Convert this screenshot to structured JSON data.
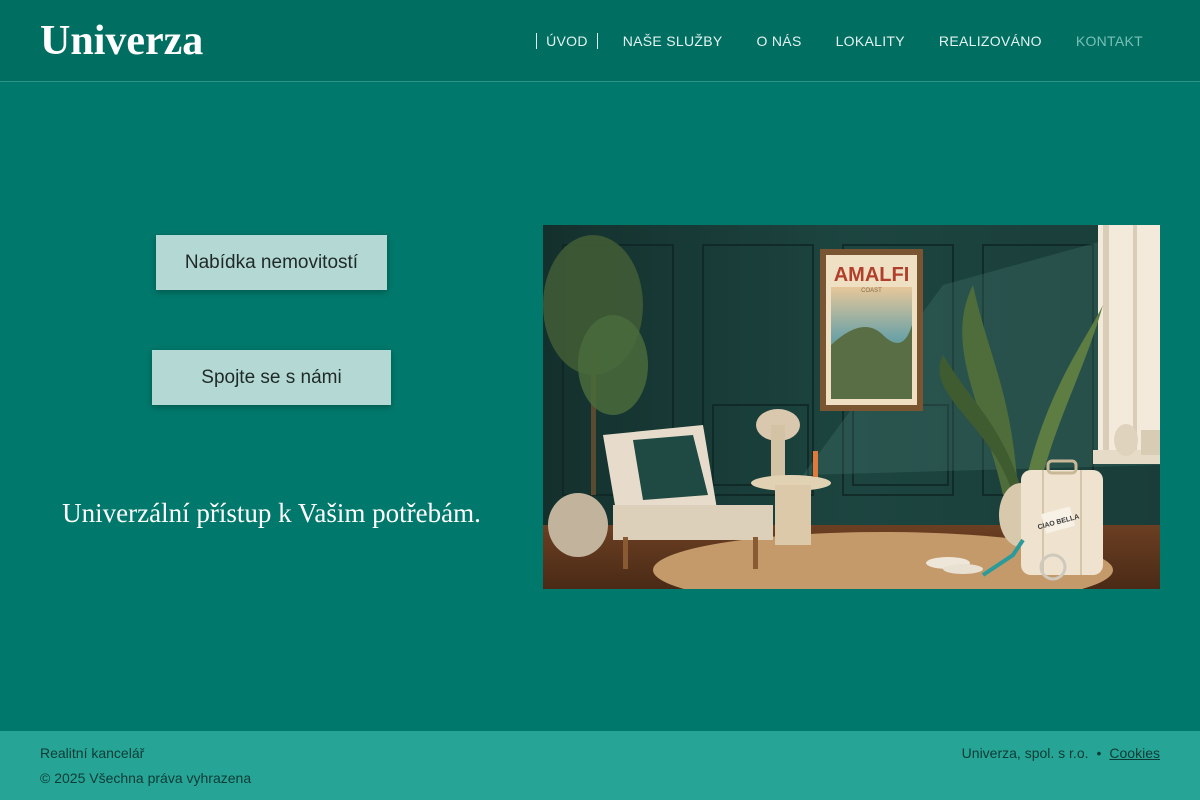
{
  "header": {
    "logo": "Univerza",
    "nav": [
      {
        "label": "ÚVOD"
      },
      {
        "label": "NAŠE SLUŽBY"
      },
      {
        "label": "O NÁS"
      },
      {
        "label": "LOKALITY"
      },
      {
        "label": "REALIZOVÁNO"
      },
      {
        "label": "KONTAKT"
      }
    ]
  },
  "hero": {
    "button_offers": "Nabídka nemovitostí",
    "button_contact": "Spojte se s námi",
    "tagline": "Univerzální přístup k Vašim potřebám.",
    "image": {
      "poster_text": "AMALFI",
      "poster_sub": "COAST",
      "tag_text": "CIAO BELLA"
    }
  },
  "footer": {
    "left_line1": "Realitní kancelář",
    "left_line2": "© 2025 Všechna práva vyhrazena",
    "company": "Univerza, spol. s r.o.",
    "separator": "•",
    "cookies": "Cookies"
  },
  "colors": {
    "background": "#00786b",
    "header": "#016e62",
    "button": "#b4d9d4",
    "footer": "#26a597"
  }
}
